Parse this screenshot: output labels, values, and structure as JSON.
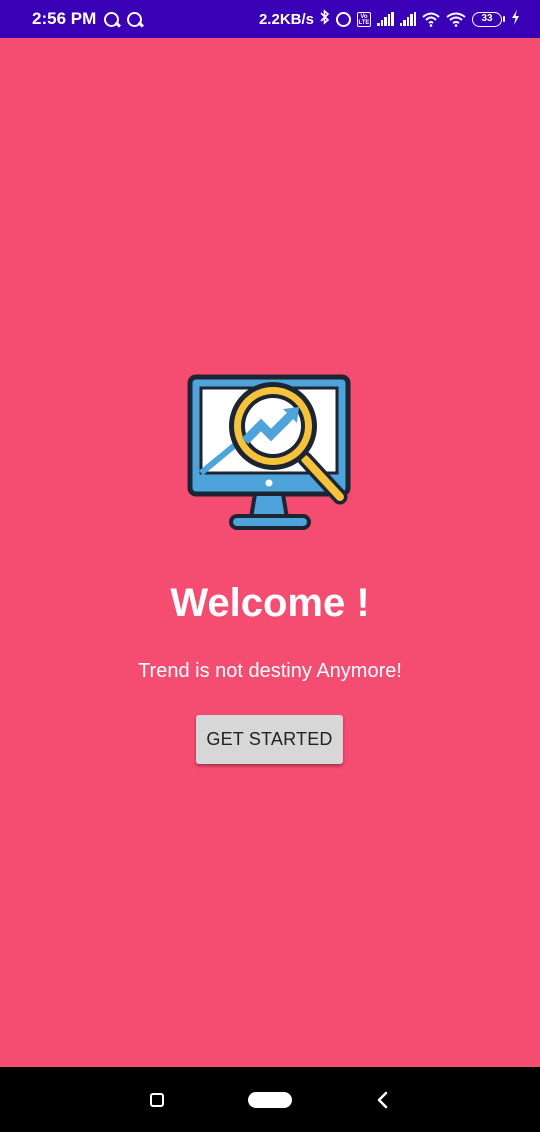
{
  "status_bar": {
    "time": "2:56 PM",
    "speed": "2.2KB/s",
    "battery": "33",
    "icons": [
      "q-icon",
      "q-icon",
      "bluetooth-icon",
      "alarm-icon",
      "volte-icon",
      "signal-icon",
      "signal-icon",
      "wifi-icon",
      "wifi-icon",
      "battery-icon",
      "charging-icon"
    ]
  },
  "main": {
    "title": "Welcome !",
    "subtitle": "Trend is not destiny Anymore!",
    "button_label": "GET STARTED",
    "hero_icon": "monitor-magnifier-trend-icon"
  },
  "nav_bar": {
    "icons": [
      "recent-apps-icon",
      "home-icon",
      "back-icon"
    ]
  },
  "colors": {
    "background": "#F54C72",
    "status_bar": "#3A00B5",
    "button_bg": "#D7D7D7",
    "nav_bar": "#000000"
  }
}
